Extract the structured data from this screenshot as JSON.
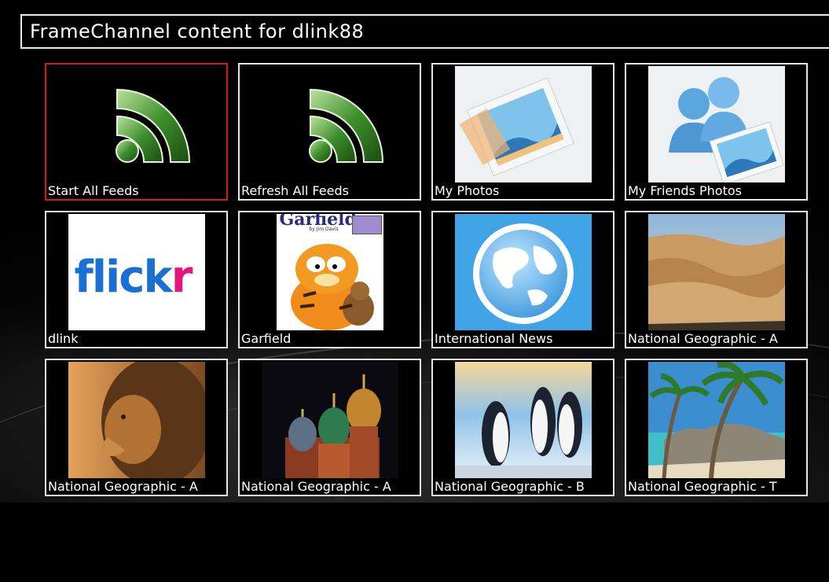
{
  "header": {
    "title": "FrameChannel content for dlink88"
  },
  "tiles": [
    {
      "label": "Start All Feeds",
      "icon": "rss-feed-icon",
      "selected": true
    },
    {
      "label": "Refresh All Feeds",
      "icon": "rss-feed-icon",
      "selected": false
    },
    {
      "label": "My Photos",
      "icon": "photos-icon",
      "selected": false
    },
    {
      "label": "My Friends Photos",
      "icon": "friends-photos-icon",
      "selected": false
    },
    {
      "label": "dlink",
      "icon": "flickr-logo",
      "logo_text": "flickr",
      "selected": false
    },
    {
      "label": "Garfield",
      "icon": "garfield-thumbnail",
      "logo_text": "Garfield",
      "byline": "by Jim Davis",
      "selected": false
    },
    {
      "label": "International News",
      "icon": "globe-icon",
      "selected": false
    },
    {
      "label": "National Geographic - A",
      "icon": "desert-dunes-thumbnail",
      "selected": false
    },
    {
      "label": "National Geographic - A",
      "icon": "lion-thumbnail",
      "selected": false
    },
    {
      "label": "National Geographic - A",
      "icon": "cathedral-domes-thumbnail",
      "selected": false
    },
    {
      "label": "National Geographic - B",
      "icon": "penguins-thumbnail",
      "selected": false
    },
    {
      "label": "National Geographic - T",
      "icon": "tropical-beach-thumbnail",
      "selected": false
    }
  ],
  "colors": {
    "selection_border": "#d41a1a",
    "tile_border": "#e6e6e6",
    "background": "#000000"
  }
}
